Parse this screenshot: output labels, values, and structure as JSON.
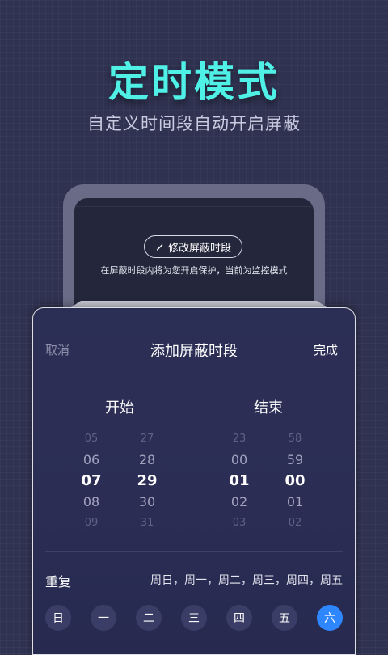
{
  "hero": {
    "title": "定时模式",
    "subtitle": "自定义时间段自动开启屏蔽"
  },
  "phone": {
    "edit_button_label": "修改屏蔽时段",
    "protection_text": "在屏蔽时段内将为您开启保护，当前为监控模式"
  },
  "sheet": {
    "cancel_label": "取消",
    "title": "添加屏蔽时段",
    "done_label": "完成",
    "start_label": "开始",
    "end_label": "结束",
    "start_hour": [
      "05",
      "06",
      "07",
      "08",
      "09"
    ],
    "start_minute": [
      "27",
      "28",
      "29",
      "30",
      "31"
    ],
    "end_hour": [
      "23",
      "00",
      "01",
      "02",
      "03"
    ],
    "end_minute": [
      "58",
      "59",
      "00",
      "01",
      "02"
    ],
    "repeat_label": "重复",
    "repeat_value": "周日，周一，周二，周三，周四，周五",
    "days": [
      "日",
      "一",
      "二",
      "三",
      "四",
      "五",
      "六"
    ],
    "active_day_index": 6
  },
  "colors": {
    "accent_title": "#4ff0e6",
    "active_day": "#2f87ff",
    "background": "#2f3250"
  },
  "icons": {
    "edit": "pencil-icon"
  }
}
